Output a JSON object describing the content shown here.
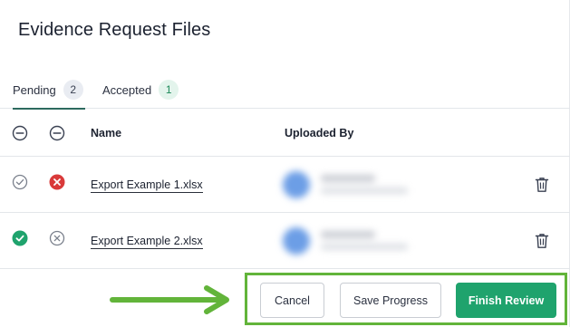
{
  "title": "Evidence Request Files",
  "tabs": [
    {
      "label": "Pending",
      "count": "2"
    },
    {
      "label": "Accepted",
      "count": "1"
    }
  ],
  "table": {
    "headers": {
      "name": "Name",
      "uploaded_by": "Uploaded By"
    },
    "rows": [
      {
        "name": "Export Example 1.xlsx",
        "accept_state": "unselected",
        "reject_state": "selected"
      },
      {
        "name": "Export Example 2.xlsx",
        "accept_state": "selected",
        "reject_state": "unselected"
      }
    ]
  },
  "actions": {
    "cancel": "Cancel",
    "save": "Save Progress",
    "finish": "Finish Review"
  },
  "colors": {
    "accept_green": "#1fa36d",
    "reject_red": "#d93a3a",
    "highlight_green": "#62b43a",
    "tab_underline": "#2d6a5e"
  },
  "icons": [
    "minus-circle-icon",
    "check-circle-icon",
    "x-circle-icon",
    "trash-icon",
    "arrow-right-icon",
    "user-avatar"
  ]
}
